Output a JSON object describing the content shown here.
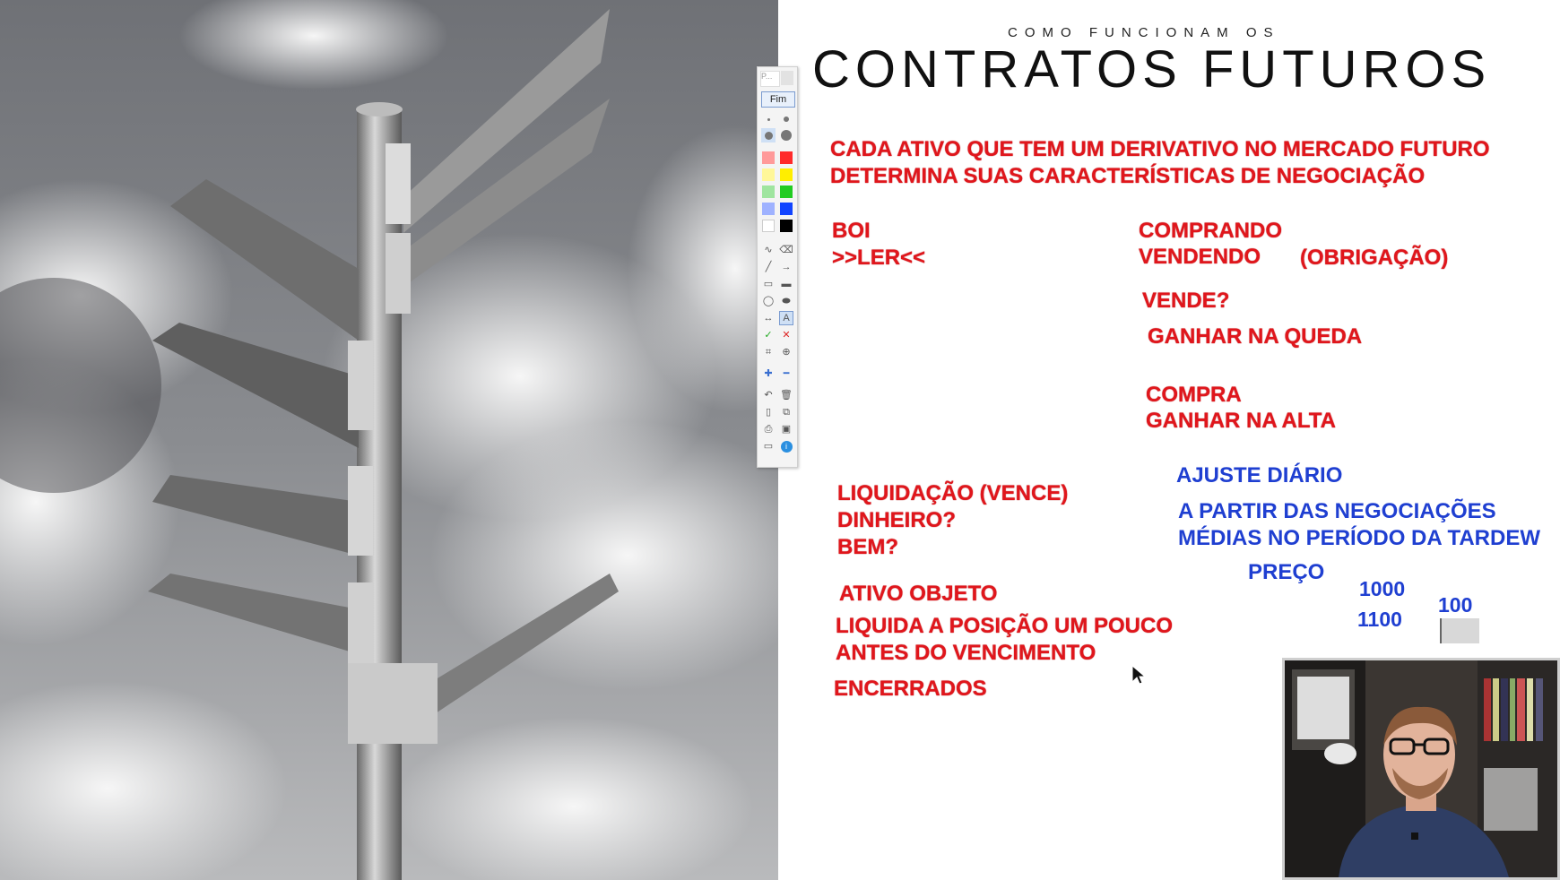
{
  "slide": {
    "subtitle": "COMO FUNCIONAM OS",
    "title": "CONTRATOS FUTUROS",
    "intro_line1": "CADA ATIVO QUE TEM UM DERIVATIVO NO MERCADO FUTURO",
    "intro_line2": "DETERMINA SUAS CARACTERÍSTICAS DE NEGOCIAÇÃO",
    "boi": "BOI",
    "ler": ">>LER<<",
    "comprando": "COMPRANDO",
    "vendendo": "VENDENDO",
    "obrigacao": "(OBRIGAÇÃO)",
    "vende": "VENDE?",
    "ganhar_queda": "GANHAR NA QUEDA",
    "compra": "COMPRA",
    "ganhar_alta": "GANHAR NA ALTA",
    "liquidacao": "LIQUIDAÇÃO (VENCE)",
    "dinheiro": "DINHEIRO?",
    "bem": "BEM?",
    "ativo_objeto": "ATIVO OBJETO",
    "liquida_1": "LIQUIDA A POSIÇÃO UM POUCO",
    "liquida_2": "ANTES DO VENCIMENTO",
    "encerrados": "ENCERRADOS",
    "ajuste": "AJUSTE DIÁRIO",
    "a_partir": "A PARTIR DAS NEGOCIAÇÕES",
    "medias": "MÉDIAS NO PERÍODO DA TARDEW",
    "preco": "PREÇO",
    "v1000": "1000",
    "v1100": "1100",
    "v100": "100"
  },
  "toolbar": {
    "top_label": "P...",
    "fim_label": "Fim",
    "colors": [
      "#ff2a2a",
      "#ffee00",
      "#22cc22",
      "#1144ff",
      "#000000"
    ],
    "icons": [
      "pen-icon",
      "eraser-icon",
      "line-icon",
      "arrow-icon",
      "rectangle-icon",
      "filled-rectangle-icon",
      "ellipse-icon",
      "filled-ellipse-icon",
      "double-arrow-icon",
      "text-icon",
      "check-icon",
      "cross-icon",
      "crop-icon",
      "zoom-icon",
      "plus-icon",
      "minus-icon",
      "undo-icon",
      "trash-icon",
      "new-page-icon",
      "copy-icon",
      "print-icon",
      "save-icon",
      "screen-icon",
      "info-icon"
    ]
  }
}
